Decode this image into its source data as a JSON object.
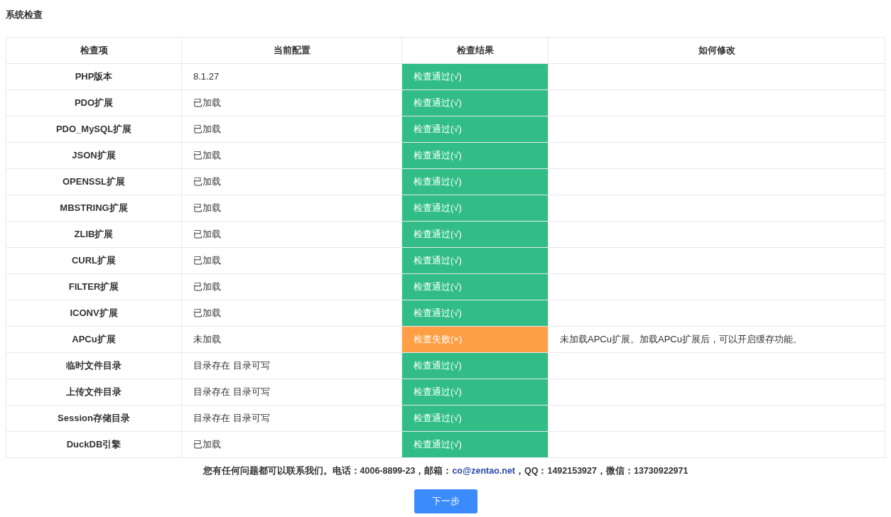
{
  "title": "系统检查",
  "table": {
    "columns": [
      "检查项",
      "当前配置",
      "检查结果",
      "如何修改"
    ],
    "rows": [
      {
        "item": "PHP版本",
        "config": "8.1.27",
        "kind": "pass",
        "result": "检查通过(√)"
      },
      {
        "item": "PDO扩展",
        "config": "已加载",
        "kind": "pass",
        "result": "检查通过(√)"
      },
      {
        "item": "PDO_MySQL扩展",
        "config": "已加载",
        "kind": "pass",
        "result": "检查通过(√)"
      },
      {
        "item": "JSON扩展",
        "config": "已加载",
        "kind": "pass",
        "result": "检查通过(√)"
      },
      {
        "item": "OPENSSL扩展",
        "config": "已加载",
        "kind": "pass",
        "result": "检查通过(√)"
      },
      {
        "item": "MBSTRING扩展",
        "config": "已加载",
        "kind": "pass",
        "result": "检查通过(√)"
      },
      {
        "item": "ZLIB扩展",
        "config": "已加载",
        "kind": "pass",
        "result": "检查通过(√)"
      },
      {
        "item": "CURL扩展",
        "config": "已加载",
        "kind": "pass",
        "result": "检查通过(√)"
      },
      {
        "item": "FILTER扩展",
        "config": "已加载",
        "kind": "pass",
        "result": "检查通过(√)"
      },
      {
        "item": "ICONV扩展",
        "config": "已加载",
        "kind": "pass",
        "result": "检查通过(√)"
      },
      {
        "item": "APCu扩展",
        "config": "未加载",
        "kind": "fail",
        "result": "检查失败(×)",
        "fix": "未加载APCu扩展。加载APCu扩展后，可以开启缓存功能。"
      },
      {
        "item": "临时文件目录",
        "config": "目录存在 目录可写",
        "kind": "pass",
        "result": "检查通过(√)"
      },
      {
        "item": "上传文件目录",
        "config": "目录存在 目录可写",
        "kind": "pass",
        "result": "检查通过(√)"
      },
      {
        "item": "Session存储目录",
        "config": "目录存在 目录可写",
        "kind": "pass",
        "result": "检查通过(√)"
      },
      {
        "item": "DuckDB引擎",
        "config": "已加载",
        "kind": "pass",
        "result": "检查通过(√)"
      }
    ]
  },
  "footer": {
    "before": "您有任何问题都可以联系我们。电话：4006-8899-23，邮箱：",
    "link": "co@zentao.net",
    "after": "，QQ：1492153927，微信：13730922971"
  },
  "next_button": "下一步"
}
